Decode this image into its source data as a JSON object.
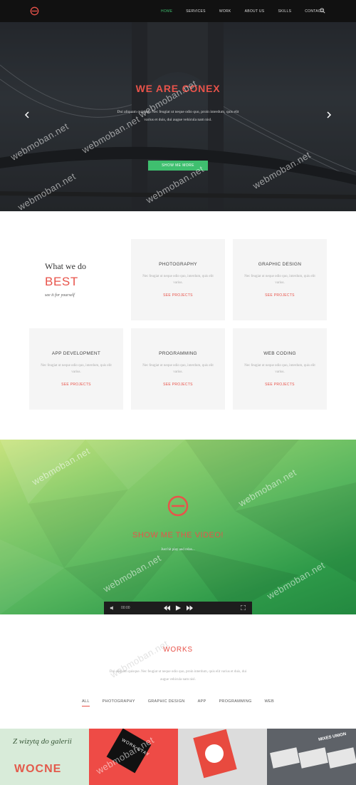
{
  "nav": {
    "items": [
      "HOME",
      "SERVICES",
      "WORK",
      "ABOUT US",
      "SKILLS",
      "CONTACT"
    ],
    "active_index": 0,
    "logo_color": "#e8534a",
    "accent_color": "#3fbf6f"
  },
  "hero": {
    "title": "WE ARE CONEX",
    "text": "Dui aliquam quisque. Nec feugiat ut neque odio quo, proin interdum, quis elit varius et duis, dui augue vehicula nam nisl.",
    "button_label": "SHOW ME MORE",
    "prev_icon": "chevron-left-icon",
    "next_icon": "chevron-right-icon"
  },
  "services": {
    "heading_small": "What we do",
    "heading_big": "BEST",
    "subheading": "see it for yourself",
    "cards": [
      {
        "title": "PHOTOGRAPHY",
        "text": "Nec feugiat ut neque odio quo, interdum, quis elit varius.",
        "link": "SEE PROJECTS"
      },
      {
        "title": "GRAPHIC DESIGN",
        "text": "Nec feugiat ut neque odio quo, interdum, quis elit varius.",
        "link": "SEE PROJECTS"
      },
      {
        "title": "APP DEVELOPMENT",
        "text": "Nec feugiat ut neque odio quo, interdum, quis elit varius.",
        "link": "SEE PROJECTS"
      },
      {
        "title": "PROGRAMMING",
        "text": "Nec feugiat ut neque odio quo, interdum, quis elit varius.",
        "link": "SEE PROJECTS"
      },
      {
        "title": "WEB CODING",
        "text": "Nec feugiat ut neque odio quo, interdum, quis elit varius.",
        "link": "SEE PROJECTS"
      }
    ]
  },
  "video": {
    "title": "SHOW ME THE VIDEO!",
    "subtitle": "Just hit play and relax...",
    "time": "00:00",
    "controls": [
      "volume-icon",
      "rewind-icon",
      "play-icon",
      "forward-icon",
      "fullscreen-icon"
    ]
  },
  "works": {
    "title": "WORKS",
    "text": "Dui aliquam quisque. Nec feugiat ut neque odio quo, proin interdum, quis elit varius et duis, dui augue vehicula nam nisl.",
    "filters": [
      "ALL",
      "PHOTOGRAPHY",
      "GRAPHIC DESIGN",
      "APP",
      "PROGRAMMING",
      "WEB"
    ],
    "active_filter": 0
  },
  "gallery": {
    "tile1_text": "Z wizytą do galerii",
    "tile1_big": "WOCNE",
    "tile2_text": "WORK STAY",
    "tile4_text": "MIXES UNION"
  },
  "watermark": "webmoban.net"
}
